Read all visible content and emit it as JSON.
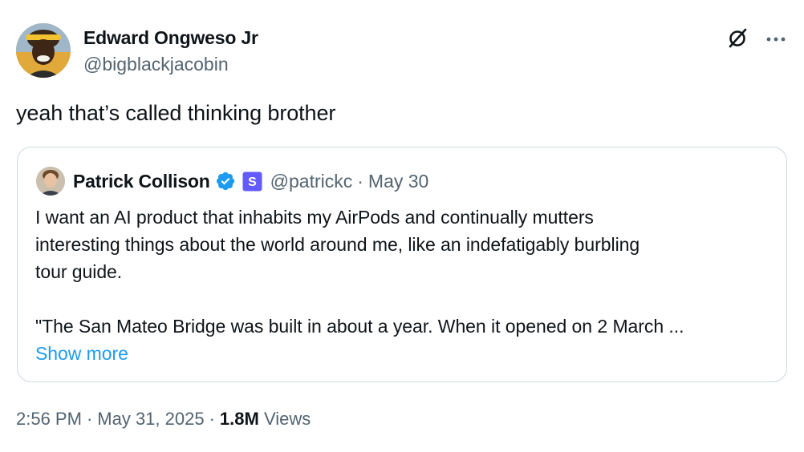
{
  "author": {
    "name": "Edward Ongweso Jr",
    "handle": "@bigblackjacobin"
  },
  "tweet": {
    "text": "yeah that’s called thinking brother"
  },
  "quoted": {
    "name": "Patrick Collison",
    "handle": "@patrickc",
    "separator": "·",
    "date": "May 30",
    "affiliate_badge": "S",
    "lines": [
      "I want an AI product that inhabits my AirPods and continually mutters",
      "interesting things about the world around me, like an indefatigably burbling",
      "tour guide.",
      "\"The San Mateo Bridge was built in about a year. When it opened on 2 March ..."
    ],
    "show_more": "Show more"
  },
  "meta": {
    "time": "2:56 PM",
    "separator": "·",
    "date": "May 31, 2025",
    "views_count": "1.8M",
    "views_label": "Views"
  },
  "icons": {
    "grok": "slashed-circle-icon",
    "more": "more-dots-icon",
    "verified": "verified-badge-icon"
  },
  "colors": {
    "text": "#0f1419",
    "secondary": "#536471",
    "link": "#1d9bf0",
    "border": "#cfd9de",
    "verified": "#1d9bf0",
    "affiliate": "#635bff"
  }
}
